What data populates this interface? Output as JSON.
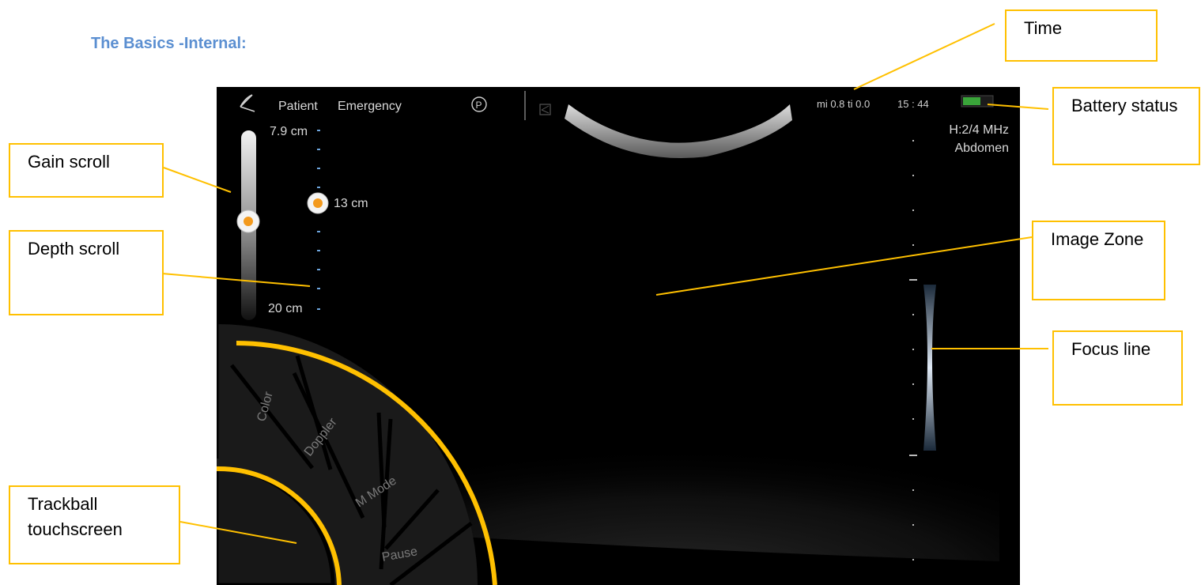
{
  "heading": "The Basics -Internal:",
  "topbar": {
    "patient": "Patient",
    "emergency": "Emergency",
    "p_symbol": "Ⓟ",
    "mi_ti": "mi 0.8 ti 0.0",
    "time": "15 : 44"
  },
  "probe": {
    "freq": "H:2/4 MHz",
    "preset": "Abdomen"
  },
  "depth": {
    "top": "7.9 cm",
    "current": "13 cm",
    "bottom": "20 cm",
    "slider_level": 0.32
  },
  "gain": {
    "slider_level": 0.4
  },
  "wheel": {
    "items": [
      "Color",
      "Doppler",
      "M Mode",
      "Pause"
    ]
  },
  "callouts": {
    "time": "Time",
    "battery": "Battery status",
    "gain": "Gain scroll",
    "depth": "Depth scroll",
    "image_zone": "Image Zone",
    "focus": "Focus line",
    "trackball": "Trackball touchscreen"
  },
  "colors": {
    "accent_orange": "#ffc000",
    "slider_dot": "#f39a1e",
    "heading_blue": "#5b8fd1",
    "battery_green": "#3aa53a"
  },
  "icons": [
    "logo-icon",
    "p-circle-icon",
    "freeze-icon",
    "battery-icon"
  ]
}
